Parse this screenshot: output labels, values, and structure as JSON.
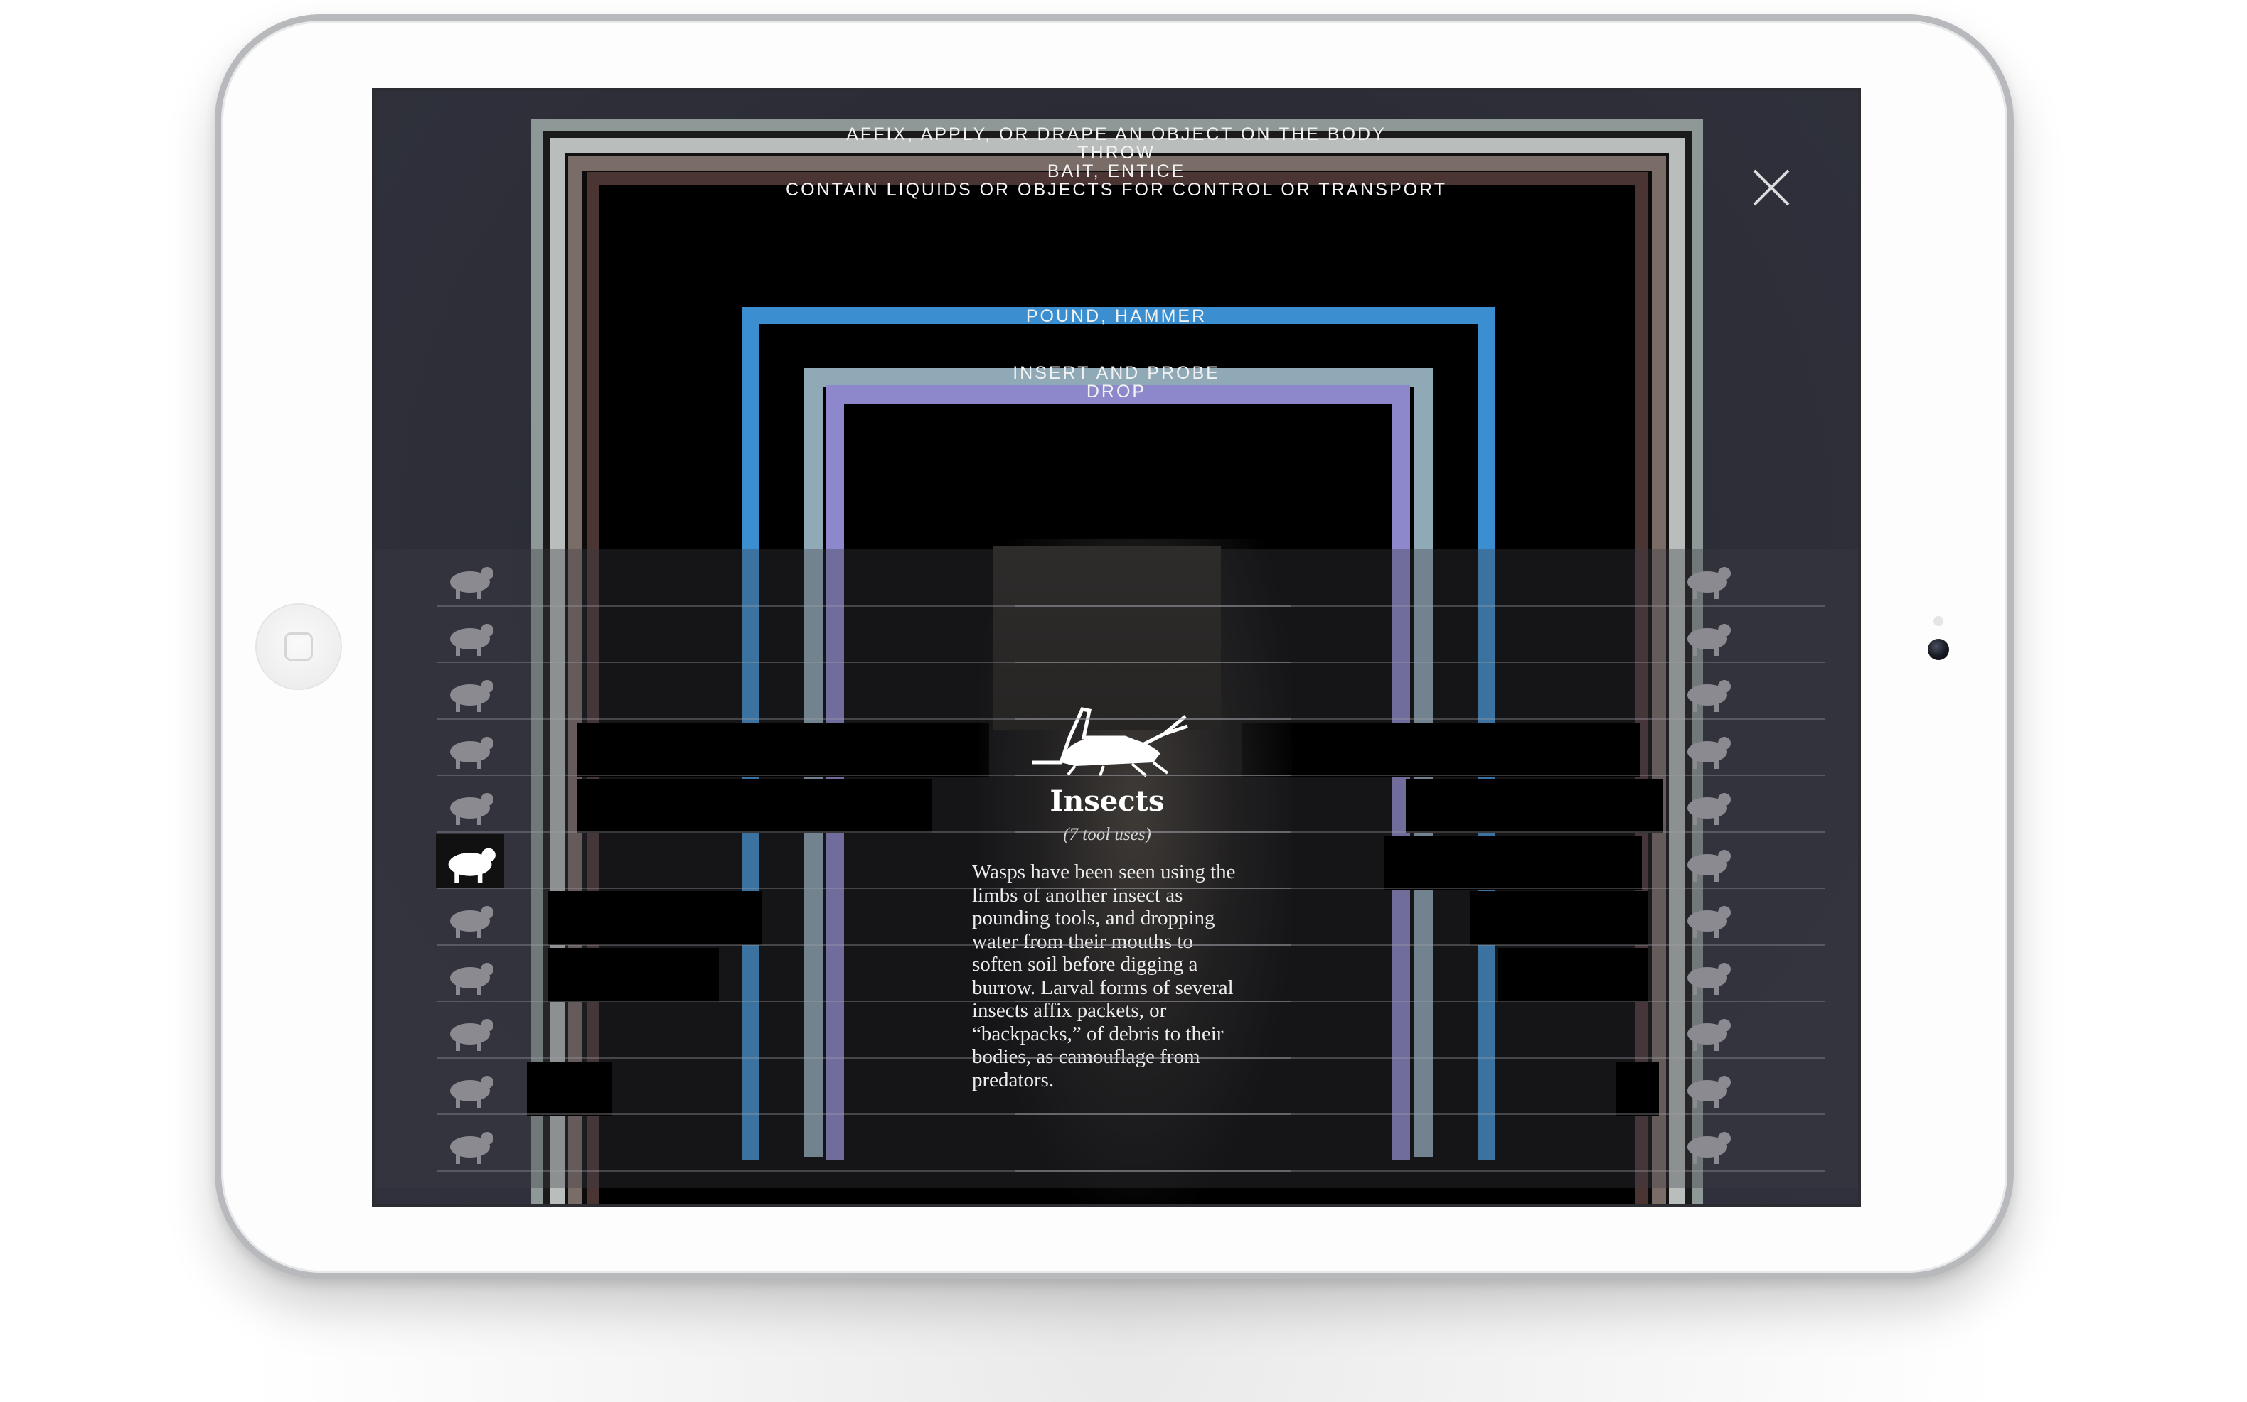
{
  "frame_labels": {
    "affix": "AFFIX, APPLY, OR DRAPE AN OBJECT ON THE BODY",
    "throw": "THROW",
    "bait": "BAIT, ENTICE",
    "contain": "CONTAIN LIQUIDS OR OBJECTS FOR CONTROL OR TRANSPORT",
    "pound": "POUND, HAMMER",
    "insert": "INSERT AND PROBE",
    "drop": "DROP"
  },
  "colors": {
    "affix": "#a7b2b0",
    "throw": "#c5c7c4",
    "bait": "#8b7c74",
    "contain": "#5a3f3c",
    "pound": "#3b8fd0",
    "insert": "#8faab8",
    "drop": "#8d87cc"
  },
  "left_animals": [
    "monkey-group-icon",
    "chimp-icon",
    "monkey-icon",
    "elephant-icon",
    "rodent-icon",
    "grasshopper-icon",
    "deer-icon",
    "crab-icon",
    "spider-icon",
    "fish-icon",
    "frog-icon"
  ],
  "right_animals": [
    "monkeys-icon",
    "gorilla-icon",
    "bird-icon",
    "otter-icon",
    "lizard-icon",
    "dolphin-icon",
    "octopus-icon",
    "crab-icon",
    "mouse-icon",
    "crocodile-icon",
    "urchin-icon"
  ],
  "selected_animal": "grasshopper-icon",
  "info": {
    "title": "Insects",
    "subtitle": "(7 tool uses)",
    "body": "Wasps have been seen using the limbs of another insect as pounding tools, and dropping water from their mouths to soften soil before digging a burrow. Larval forms of several insects affix packets, or “backpacks,” of debris to their bodies, as camouflage from predators."
  },
  "close_icon": "close-icon"
}
